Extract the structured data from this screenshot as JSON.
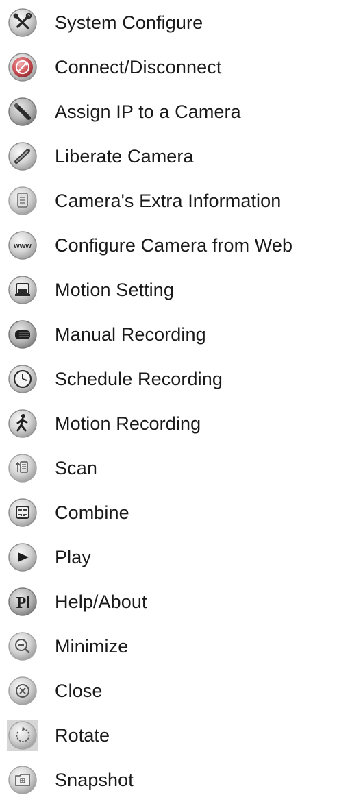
{
  "legend": {
    "items": [
      {
        "icon": "tools-icon",
        "label": "System Configure"
      },
      {
        "icon": "connect-icon",
        "label": "Connect/Disconnect"
      },
      {
        "icon": "assign-ip-icon",
        "label": "Assign IP to a Camera"
      },
      {
        "icon": "liberate-icon",
        "label": "Liberate Camera"
      },
      {
        "icon": "document-icon",
        "label": "Camera's Extra Information"
      },
      {
        "icon": "web-icon",
        "label": "Configure Camera from Web"
      },
      {
        "icon": "monitor-icon",
        "label": "Motion Setting"
      },
      {
        "icon": "recorder-icon",
        "label": "Manual Recording"
      },
      {
        "icon": "clock-icon",
        "label": "Schedule Recording"
      },
      {
        "icon": "walking-man-icon",
        "label": "Motion Recording"
      },
      {
        "icon": "scan-icon",
        "label": "Scan"
      },
      {
        "icon": "combine-icon",
        "label": "Combine"
      },
      {
        "icon": "play-icon",
        "label": "Play"
      },
      {
        "icon": "help-icon",
        "label": "Help/About"
      },
      {
        "icon": "minimize-icon",
        "label": "Minimize"
      },
      {
        "icon": "close-icon",
        "label": "Close"
      },
      {
        "icon": "rotate-icon",
        "label": "Rotate"
      },
      {
        "icon": "snapshot-icon",
        "label": "Snapshot"
      }
    ],
    "web_icon_text": "www",
    "help_icon_text": "P",
    "colors": {
      "button_face": "#c9c9c9",
      "button_rim": "#8e8e8e",
      "button_highlight": "#f2f2f2",
      "glyph": "#2b2b2b",
      "connect_red": "#c9464a",
      "text": "#1a1a1a"
    }
  }
}
